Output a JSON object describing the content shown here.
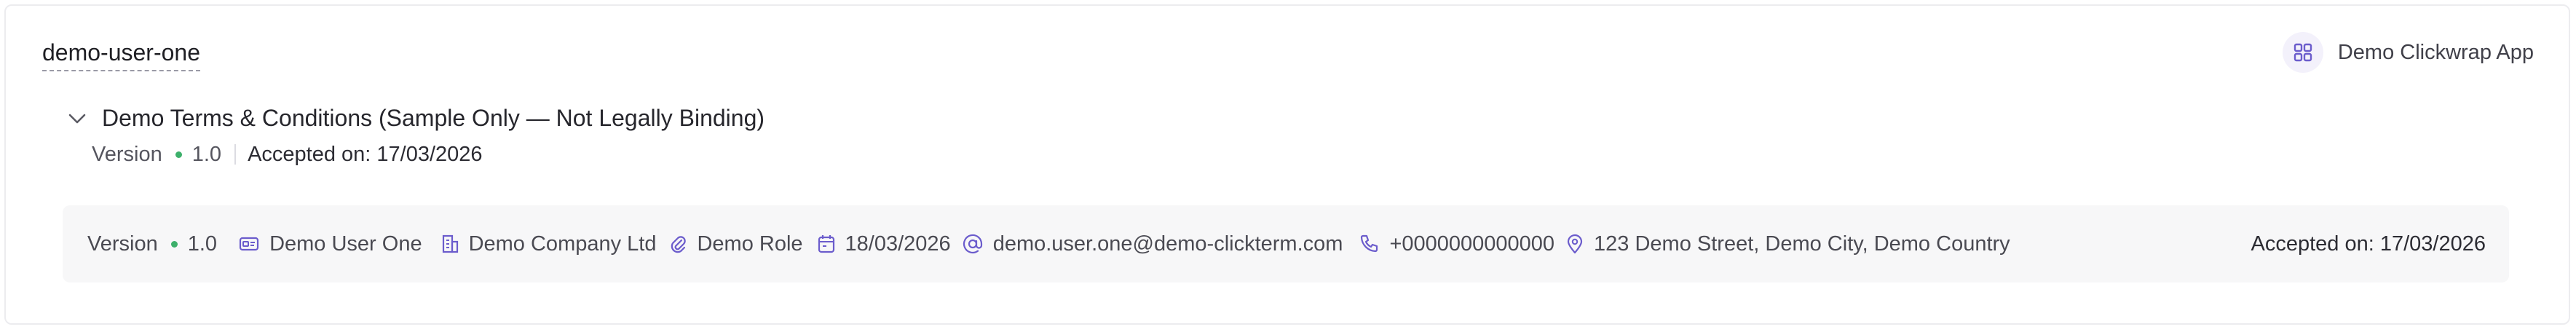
{
  "user": {
    "id": "demo-user-one"
  },
  "app": {
    "name": "Demo Clickwrap App",
    "icon": "apps-grid-icon"
  },
  "terms": {
    "title": "Demo Terms & Conditions (Sample Only — Not Legally Binding)",
    "expanded": true,
    "version_label": "Version",
    "version": "1.0",
    "accepted_label": "Accepted on: 17/03/2026",
    "status_color": "#3db06b"
  },
  "acceptance": {
    "version_label": "Version",
    "version": "1.0",
    "name": "Demo User One",
    "company": "Demo Company Ltd",
    "role": "Demo Role",
    "date": "18/03/2026",
    "email": "demo.user.one@demo-clickterm.com",
    "phone": "+0000000000000",
    "address": "123 Demo Street, Demo City, Demo Country",
    "accepted_label": "Accepted on: 17/03/2026",
    "icon_color": "#6b5ccc"
  }
}
